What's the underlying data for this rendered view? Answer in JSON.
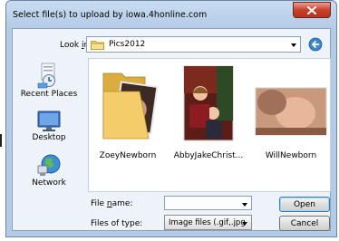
{
  "dialog": {
    "title": "Select file(s) to upload by iowa.4honline.com"
  },
  "toolbar": {
    "look_in_prefix": "Look ",
    "look_in_key": "i",
    "look_in_suffix": "n:",
    "current_folder": "Pics2012"
  },
  "places": [
    {
      "label": "Recent Places",
      "icon": "recent-places-icon"
    },
    {
      "label": "Desktop",
      "icon": "desktop-icon"
    },
    {
      "label": "Network",
      "icon": "network-icon"
    }
  ],
  "files": [
    {
      "name": "ZoeyNewborn",
      "type": "folder"
    },
    {
      "name": "AbbyJakeChrist...",
      "type": "image"
    },
    {
      "name": "WillNewborn",
      "type": "image"
    }
  ],
  "form": {
    "file_name_prefix": "File ",
    "file_name_key": "n",
    "file_name_suffix": "ame:",
    "file_name_value": "",
    "file_type_label": "Files of type:",
    "file_type_value": "Image files (.gif,.jpg"
  },
  "buttons": {
    "open": "Open",
    "cancel": "Cancel"
  },
  "colors": {
    "title_bar": "#b4cbe6",
    "close_button": "#c7422c",
    "default_button_border": "#3c7fb1"
  }
}
